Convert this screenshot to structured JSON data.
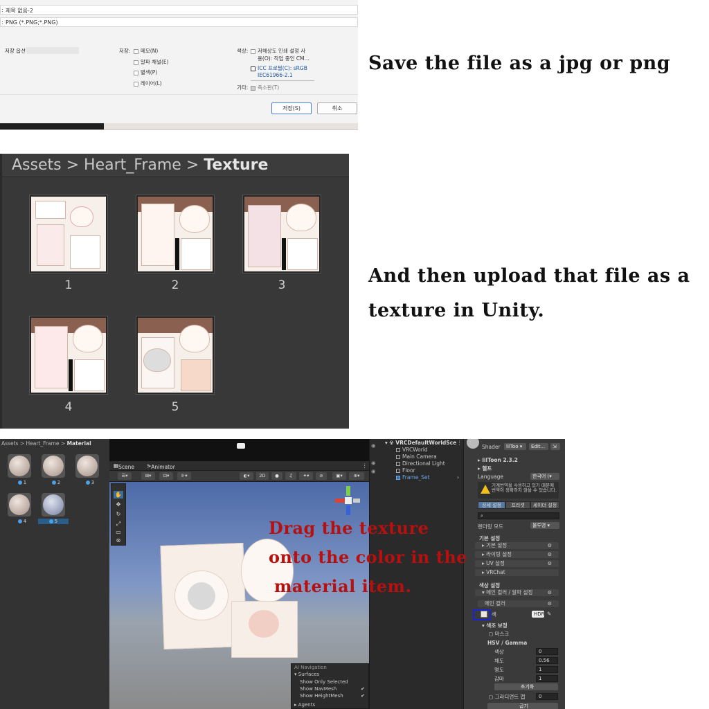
{
  "notes": {
    "save": "Save the file as a jpg or png",
    "upload": "And then upload that file as a texture in Unity.",
    "drag_line1": "Drag the texture",
    "drag_line2": "onto the color in the",
    "drag_line3": "material item."
  },
  "save_dialog": {
    "filename_prefix": ":",
    "filename": "제목 없음-2",
    "filetype_prefix": ":",
    "filetype": "PNG (*.PNG;*.PNG)",
    "save_options": "저장 옵션",
    "save_label": "저장:",
    "options": [
      "메모(N)",
      "알파 채널(E)",
      "별색(P)",
      "레이어(L)"
    ],
    "color_label": "색상:",
    "color_opt1_line1": "저해상도 인쇄 설정 사",
    "color_opt1_line2": "용(O): 작업 중인 CM...",
    "icc_line1": "ICC 프로필(C): sRGB",
    "icc_line2": "IEC61966-2.1",
    "other_label": "기타:",
    "thumbnail": "축소판(T)",
    "save_button": "저장(S)",
    "cancel_button": "취소"
  },
  "asset_browser": {
    "crumb_assets": "Assets",
    "crumb_sep1": ">",
    "crumb_folder": "Heart_Frame",
    "crumb_sep2": ">",
    "crumb_current": "Texture",
    "items": [
      "1",
      "2",
      "3",
      "4",
      "5"
    ]
  },
  "unity": {
    "project_path_assets": "Assets",
    "project_path_sep1": ">",
    "project_path_folder": "Heart_Frame",
    "project_path_sep2": ">",
    "project_path_current": "Material",
    "materials": [
      "1",
      "2",
      "3",
      "4",
      "5"
    ],
    "scene_tab": "Scene",
    "animator_tab": "Animator",
    "toolbar_2d": "2D",
    "ai_nav": {
      "title": "AI Navigation",
      "surfaces": "Surfaces",
      "show_only_selected": "Show Only Selected",
      "show_navmesh": "Show NavMesh",
      "show_heightmesh": "Show HeightMesh",
      "agents": "Agents"
    },
    "hierarchy": {
      "root": "VRCDefaultWorldSce",
      "items": [
        "VRCWorld",
        "Main Camera",
        "Directional Light",
        "Floor",
        "Frame_Set"
      ]
    },
    "inspector": {
      "shader_label": "Shader",
      "shader_value": "lilToo",
      "edit_button": "Edit...",
      "version": "lilToon 2.3.2",
      "help": "헬프",
      "language_label": "Language",
      "language_value": "한국어 (",
      "warning": "기계번역을 사용하고 있기 때문에 번역이 정확하지 않을 수 있습니다.",
      "tabs": [
        "상세 설정",
        "프리셋",
        "셰이더 설정"
      ],
      "render_mode_label": "렌더링 모드",
      "render_mode_value": "불투명",
      "basic_settings": "기본 설정",
      "folds": [
        "기본 설정",
        "라이팅 설정",
        "UV 설정",
        "VRChat"
      ],
      "color_settings": "색상 설정",
      "main_color_alpha": "메인 컬러 / 알파 설정",
      "main_color": "메인 컬러",
      "color_label": "색",
      "hdr": "HDR",
      "color_correction": "색조 보정",
      "mask": "마스크",
      "hsv_gamma": "HSV / Gamma",
      "hue_label": "색상",
      "hue_value": "0",
      "saturation_label": "채도",
      "saturation_value": "0.56",
      "brightness_label": "명도",
      "brightness_value": "1",
      "gamma_label": "감마",
      "gamma_value": "1",
      "reset_button": "초기화",
      "gradient_map": "그라디언트 맵",
      "gradient_value": "0",
      "bake_button": "굽기"
    }
  }
}
